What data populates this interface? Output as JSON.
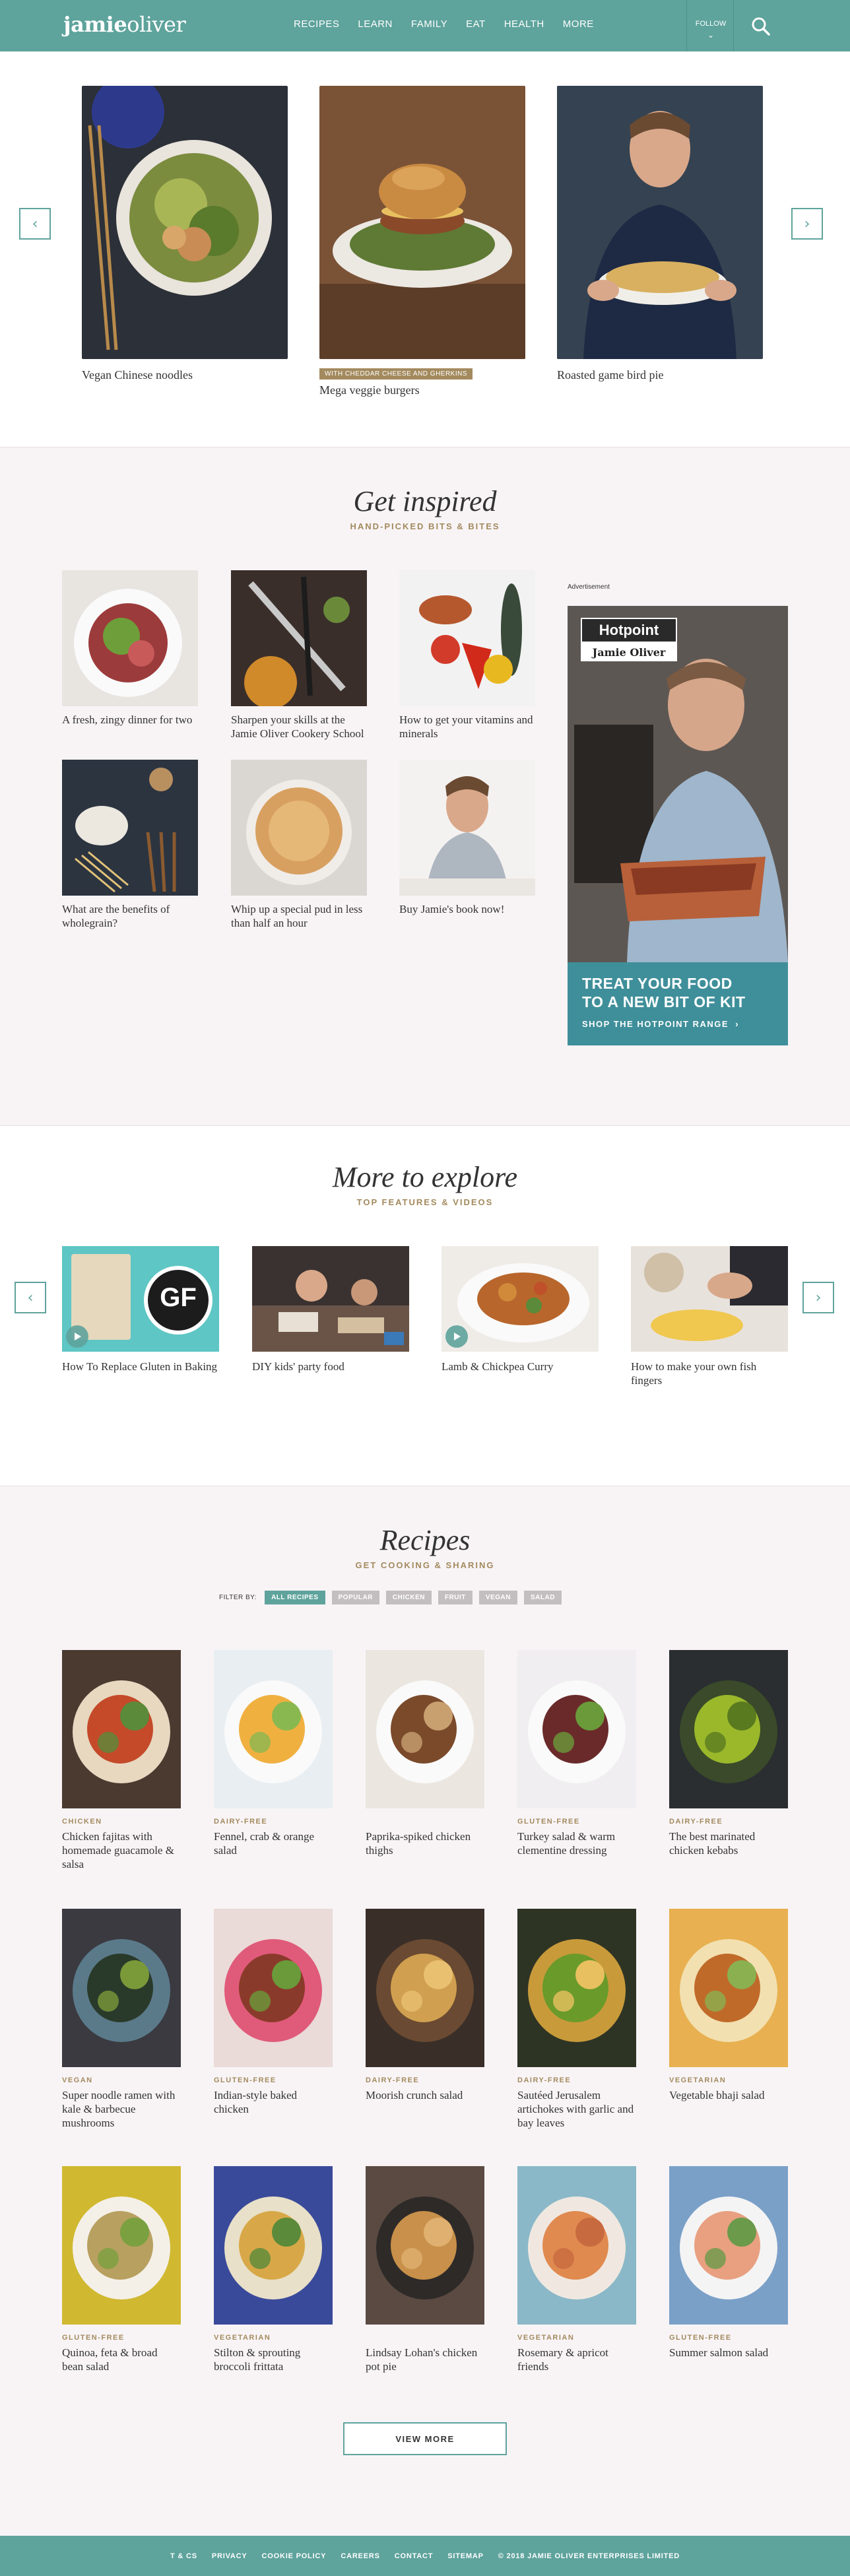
{
  "header": {
    "logo_bold": "jamie",
    "logo_light": "oliver",
    "nav": [
      "RECIPES",
      "LEARN",
      "FAMILY",
      "EAT",
      "HEALTH",
      "MORE"
    ],
    "follow": "FOLLOW"
  },
  "hero": {
    "cards": [
      {
        "caption": "Vegan Chinese noodles",
        "tag": ""
      },
      {
        "caption": "Mega veggie burgers",
        "tag": "WITH CHEDDAR CHEESE AND GHERKINS"
      },
      {
        "caption": "Roasted game bird pie",
        "tag": ""
      }
    ]
  },
  "inspired": {
    "title": "Get inspired",
    "subtitle": "HAND-PICKED BITS & BITES",
    "tiles": [
      {
        "caption": "A fresh, zingy dinner for two"
      },
      {
        "caption": "Sharpen your skills at the Jamie Oliver Cookery School"
      },
      {
        "caption": "How to get your vitamins and minerals"
      },
      {
        "caption": "What are the benefits of wholegrain?"
      },
      {
        "caption": "Whip up a special pud in less than half an hour"
      },
      {
        "caption": "Buy Jamie's book now!"
      }
    ],
    "ad": {
      "label": "Advertisement",
      "brand": "Hotpoint",
      "partner": "Jamie Oliver",
      "headline_1": "TREAT YOUR FOOD",
      "headline_2": "TO A NEW BIT OF KIT",
      "cta": "SHOP THE HOTPOINT RANGE",
      "cta_arrow": "›"
    }
  },
  "explore": {
    "title": "More to explore",
    "subtitle": "TOP FEATURES & VIDEOS",
    "cards": [
      {
        "caption": "How To Replace Gluten in Baking",
        "badge": "GF"
      },
      {
        "caption": "DIY kids' party food"
      },
      {
        "caption": "Lamb & Chickpea Curry"
      },
      {
        "caption": "How to make your own fish fingers"
      }
    ]
  },
  "recipes": {
    "title": "Recipes",
    "subtitle": "GET COOKING & SHARING",
    "filter_label": "FILTER BY:",
    "filters": [
      "ALL RECIPES",
      "POPULAR",
      "CHICKEN",
      "FRUIT",
      "VEGAN",
      "SALAD"
    ],
    "items": [
      {
        "tag": "CHICKEN",
        "name": "Chicken fajitas with homemade guacamole & salsa"
      },
      {
        "tag": "DAIRY-FREE",
        "name": "Fennel, crab & orange salad"
      },
      {
        "tag": "",
        "name": "Paprika-spiked chicken thighs"
      },
      {
        "tag": "GLUTEN-FREE",
        "name": "Turkey salad & warm clementine dressing"
      },
      {
        "tag": "DAIRY-FREE",
        "name": "The best marinated chicken kebabs"
      },
      {
        "tag": "VEGAN",
        "name": "Super noodle ramen with kale & barbecue mushrooms"
      },
      {
        "tag": "GLUTEN-FREE",
        "name": "Indian-style baked chicken"
      },
      {
        "tag": "DAIRY-FREE",
        "name": "Moorish crunch salad"
      },
      {
        "tag": "DAIRY-FREE",
        "name": "Sautéed Jerusalem artichokes with garlic and bay leaves"
      },
      {
        "tag": "VEGETARIAN",
        "name": "Vegetable bhaji salad"
      },
      {
        "tag": "GLUTEN-FREE",
        "name": "Quinoa, feta & broad bean salad"
      },
      {
        "tag": "VEGETARIAN",
        "name": "Stilton & sprouting broccoli frittata"
      },
      {
        "tag": "",
        "name": "Lindsay Lohan's chicken pot pie"
      },
      {
        "tag": "VEGETARIAN",
        "name": "Rosemary & apricot friends"
      },
      {
        "tag": "GLUTEN-FREE",
        "name": "Summer salmon salad"
      }
    ],
    "view_more": "VIEW MORE"
  },
  "footer": {
    "links": [
      "T & CS",
      "PRIVACY",
      "COOKIE POLICY",
      "CAREERS",
      "CONTACT",
      "SITEMAP",
      "© 2018 JAMIE OLIVER ENTERPRISES LIMITED"
    ]
  },
  "colors": {
    "brand": "#5ea39c",
    "accent_gold": "#a38a5e",
    "background": "#f8f4f6"
  }
}
